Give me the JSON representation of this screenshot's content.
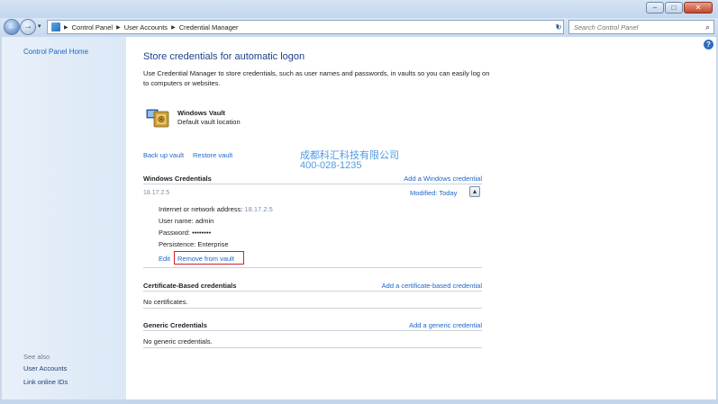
{
  "window": {
    "minimize": "–",
    "maximize": "□",
    "close": "✕"
  },
  "address": {
    "crumbs": [
      "Control Panel",
      "User Accounts",
      "Credential Manager"
    ],
    "search_placeholder": "Search Control Panel"
  },
  "sidebar": {
    "home": "Control Panel Home",
    "see_also": "See also",
    "links": [
      "User Accounts",
      "Link online IDs"
    ]
  },
  "main": {
    "title": "Store credentials for automatic logon",
    "description": "Use Credential Manager to store credentials, such as user names and passwords, in vaults so you can easily log on to computers or websites.",
    "vault_name": "Windows Vault",
    "vault_sub": "Default vault location",
    "backup": "Back up vault",
    "restore": "Restore vault",
    "watermark_line1": "成都科汇科技有限公司",
    "watermark_line2": "400-028-1235",
    "windows_credentials": {
      "heading": "Windows Credentials",
      "add_link": "Add a Windows credential",
      "entry_name": "18.17.2.5",
      "modified_label": "Modified:",
      "modified_value": "Today",
      "address_label": "Internet or network address:",
      "address_value": "18.17.2.5",
      "username_label": "User name:",
      "username_value": "admin",
      "password_label": "Password:",
      "password_value": "••••••••",
      "persistence_label": "Persistence:",
      "persistence_value": "Enterprise",
      "edit": "Edit",
      "remove": "Remove from vault"
    },
    "certificate_credentials": {
      "heading": "Certificate-Based credentials",
      "add_link": "Add a certificate-based credential",
      "empty": "No certificates."
    },
    "generic_credentials": {
      "heading": "Generic Credentials",
      "add_link": "Add a generic credential",
      "empty": "No generic credentials."
    }
  }
}
